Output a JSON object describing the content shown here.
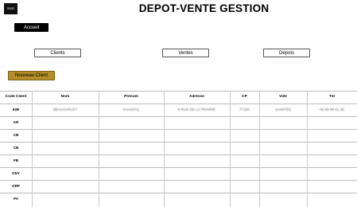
{
  "header": {
    "logo_text": "ᴅᴠɢ",
    "title": "DEPOT-VENTE GESTION"
  },
  "buttons": {
    "accueil": "Accueil",
    "nouveau_client": "Nouveau Client"
  },
  "nav": {
    "clients": "Clients",
    "ventes": "Ventes",
    "depots": "Dépots"
  },
  "table": {
    "columns": [
      "Code Client",
      "Nom",
      "Prenom",
      "Adresse",
      "CP",
      "Ville",
      "Tél"
    ],
    "rows": [
      {
        "code": "92B",
        "nom": "BEAUVARLET",
        "prenom": "CHANTAL",
        "adresse": "6 RUE DE LA PRAIRIE",
        "cp": "77100",
        "ville": "SAINTES",
        "tel": "06 89 88 51 36"
      },
      {
        "code": "AR",
        "nom": "",
        "prenom": "",
        "adresse": "",
        "cp": "",
        "ville": "",
        "tel": ""
      },
      {
        "code": "CB",
        "nom": "",
        "prenom": "",
        "adresse": "",
        "cp": "",
        "ville": "",
        "tel": ""
      },
      {
        "code": "CB",
        "nom": "",
        "prenom": "",
        "adresse": "",
        "cp": "",
        "ville": "",
        "tel": ""
      },
      {
        "code": "FB",
        "nom": "",
        "prenom": "",
        "adresse": "",
        "cp": "",
        "ville": "",
        "tel": ""
      },
      {
        "code": "ONY",
        "nom": "",
        "prenom": "",
        "adresse": "",
        "cp": "",
        "ville": "",
        "tel": ""
      },
      {
        "code": "ORP",
        "nom": "",
        "prenom": "",
        "adresse": "",
        "cp": "",
        "ville": "",
        "tel": ""
      },
      {
        "code": "PA",
        "nom": "",
        "prenom": "",
        "adresse": "",
        "cp": "",
        "ville": "",
        "tel": ""
      }
    ]
  }
}
